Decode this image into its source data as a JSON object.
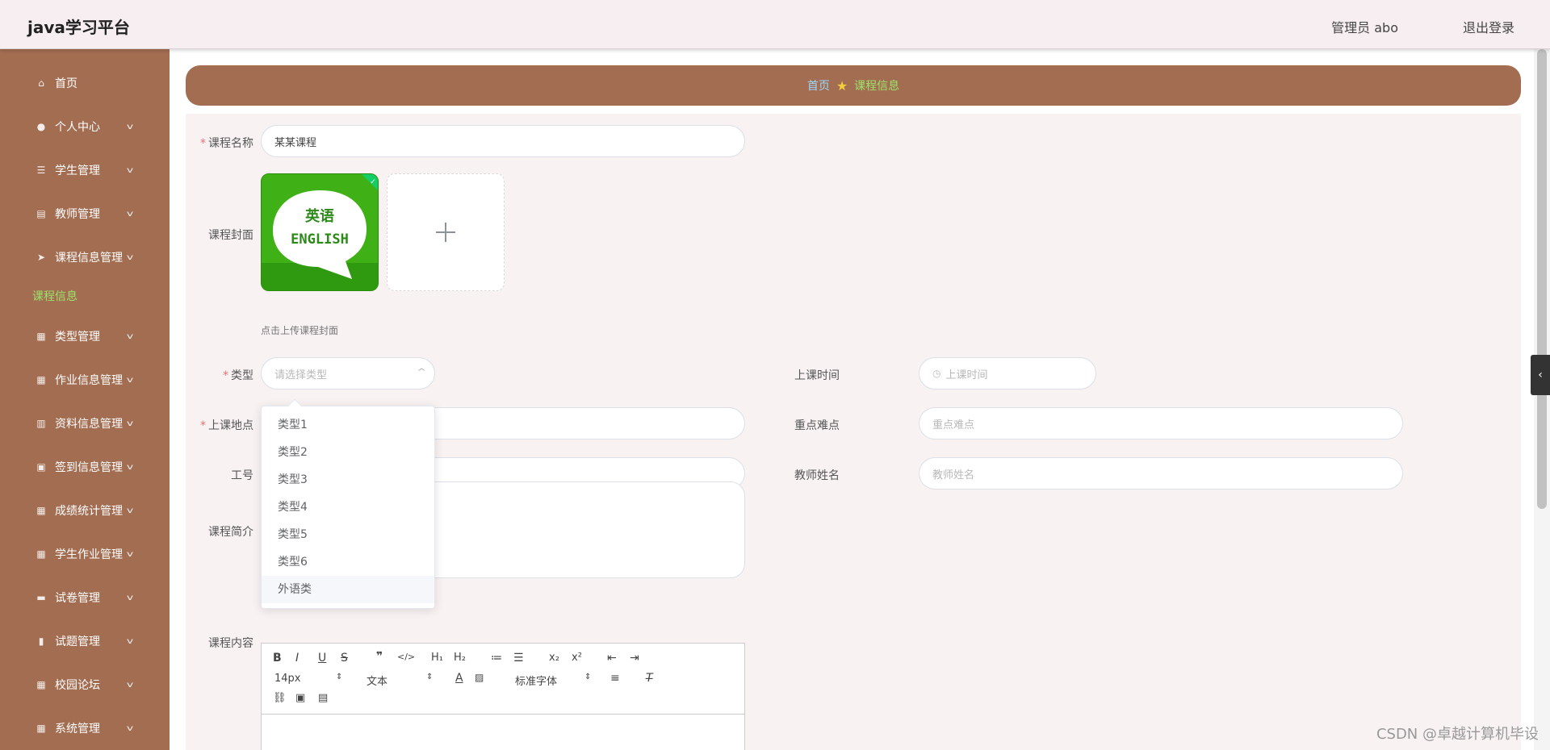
{
  "header": {
    "brand": "java学习平台",
    "user": "管理员 abo",
    "logout": "退出登录"
  },
  "sidebar": {
    "items": [
      {
        "label": "首页",
        "icon": "home-icon",
        "glyph": "⌂"
      },
      {
        "label": "个人中心",
        "icon": "user-icon",
        "glyph": "●"
      },
      {
        "label": "学生管理",
        "icon": "list-icon",
        "glyph": "☰"
      },
      {
        "label": "教师管理",
        "icon": "chart-icon",
        "glyph": "▤"
      },
      {
        "label": "课程信息管理",
        "icon": "send-icon",
        "glyph": "➤"
      },
      {
        "label": "类型管理",
        "icon": "grid-icon",
        "glyph": "▦"
      },
      {
        "label": "作业信息管理",
        "icon": "grid-icon",
        "glyph": "▦"
      },
      {
        "label": "资料信息管理",
        "icon": "document-icon",
        "glyph": "▥"
      },
      {
        "label": "签到信息管理",
        "icon": "ticket-icon",
        "glyph": "▣"
      },
      {
        "label": "成绩统计管理",
        "icon": "grid-icon",
        "glyph": "▦"
      },
      {
        "label": "学生作业管理",
        "icon": "apps-icon",
        "glyph": "▦"
      },
      {
        "label": "试卷管理",
        "icon": "monitor-icon",
        "glyph": "▬"
      },
      {
        "label": "试题管理",
        "icon": "bars-icon",
        "glyph": "▮"
      },
      {
        "label": "校园论坛",
        "icon": "grid-icon",
        "glyph": "▦"
      },
      {
        "label": "系统管理",
        "icon": "grid-icon",
        "glyph": "▦"
      }
    ],
    "active_sub": "课程信息"
  },
  "breadcrumb": {
    "home": "首页",
    "current": "课程信息"
  },
  "form": {
    "name_label": "课程名称",
    "name_value": "某某课程",
    "cover_label": "课程封面",
    "cover_text_cn": "英语",
    "cover_text_en": "ENGLISH",
    "upload_hint": "点击上传课程封面",
    "type_label": "类型",
    "type_placeholder": "请选择类型",
    "time_label": "上课时间",
    "time_placeholder": "上课时间",
    "location_label": "上课地点",
    "key_label": "重点难点",
    "key_placeholder": "重点难点",
    "job_label": "工号",
    "teacher_label": "教师姓名",
    "teacher_placeholder": "教师姓名",
    "intro_label": "课程简介",
    "content_label": "课程内容"
  },
  "dropdown": {
    "options": [
      "类型1",
      "类型2",
      "类型3",
      "类型4",
      "类型5",
      "类型6",
      "外语类"
    ]
  },
  "editor": {
    "font_size": "14px",
    "block_format": "文本",
    "font_family": "标准字体"
  },
  "watermark": "CSDN @卓越计算机毕设"
}
